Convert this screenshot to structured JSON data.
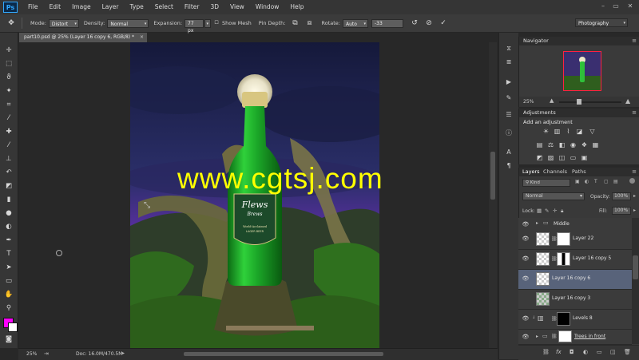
{
  "app": {
    "logo": "Ps"
  },
  "menu": [
    "File",
    "Edit",
    "Image",
    "Layer",
    "Type",
    "Select",
    "Filter",
    "3D",
    "View",
    "Window",
    "Help"
  ],
  "window_controls": [
    "–",
    "▭",
    "✕"
  ],
  "options_bar": {
    "mode_label": "Mode:",
    "mode_value": "Distort",
    "density_label": "Density:",
    "density_value": "Normal",
    "expansion_label": "Expansion:",
    "expansion_value": "77 px",
    "show_mesh_label": "Show Mesh",
    "pin_depth_label": "Pin Depth:",
    "rotate_label": "Rotate:",
    "rotate_value": "Auto",
    "rotate_angle": "-33",
    "workspace": "Photography"
  },
  "document": {
    "tab_title": "part10.psd @ 25% (Layer 16 copy 6, RGB/8) *",
    "tab_close": "×",
    "zoom": "25%",
    "doc_size": "Doc: 16.0M/470.5M"
  },
  "artwork": {
    "watermark": "www.cgtsj.com",
    "label_brand": "Flews",
    "label_sub": "Brews",
    "label_line1": "World-Acclaimed",
    "label_line2": "LAGER BEER"
  },
  "navigator": {
    "title": "Navigator",
    "zoom": "25%"
  },
  "adjustments": {
    "title": "Adjustments",
    "subtitle": "Add an adjustment"
  },
  "layers": {
    "tabs": [
      "Layers",
      "Channels",
      "Paths"
    ],
    "search_kind": "Kind",
    "blend_mode": "Normal",
    "opacity_label": "Opacity:",
    "opacity_value": "100%",
    "lock_label": "Lock:",
    "fill_label": "Fill:",
    "fill_value": "100%",
    "rows": [
      {
        "name": "Middle"
      },
      {
        "name": "Layer 22"
      },
      {
        "name": "Layer 16 copy 5"
      },
      {
        "name": "Layer 16 copy 6"
      },
      {
        "name": "Layer 16 copy 3"
      },
      {
        "name": "Levels 8"
      },
      {
        "name": "Trees in front"
      }
    ],
    "footer_icons": [
      "link-icon",
      "fx-icon",
      "mask-icon",
      "adjustment-icon",
      "folder-icon",
      "new-layer-icon",
      "trash-icon"
    ]
  },
  "colors": {
    "foreground": "#ff00ff",
    "background": "#ffffff",
    "selected_layer": "#58637a",
    "watermark": "#ffff00"
  }
}
